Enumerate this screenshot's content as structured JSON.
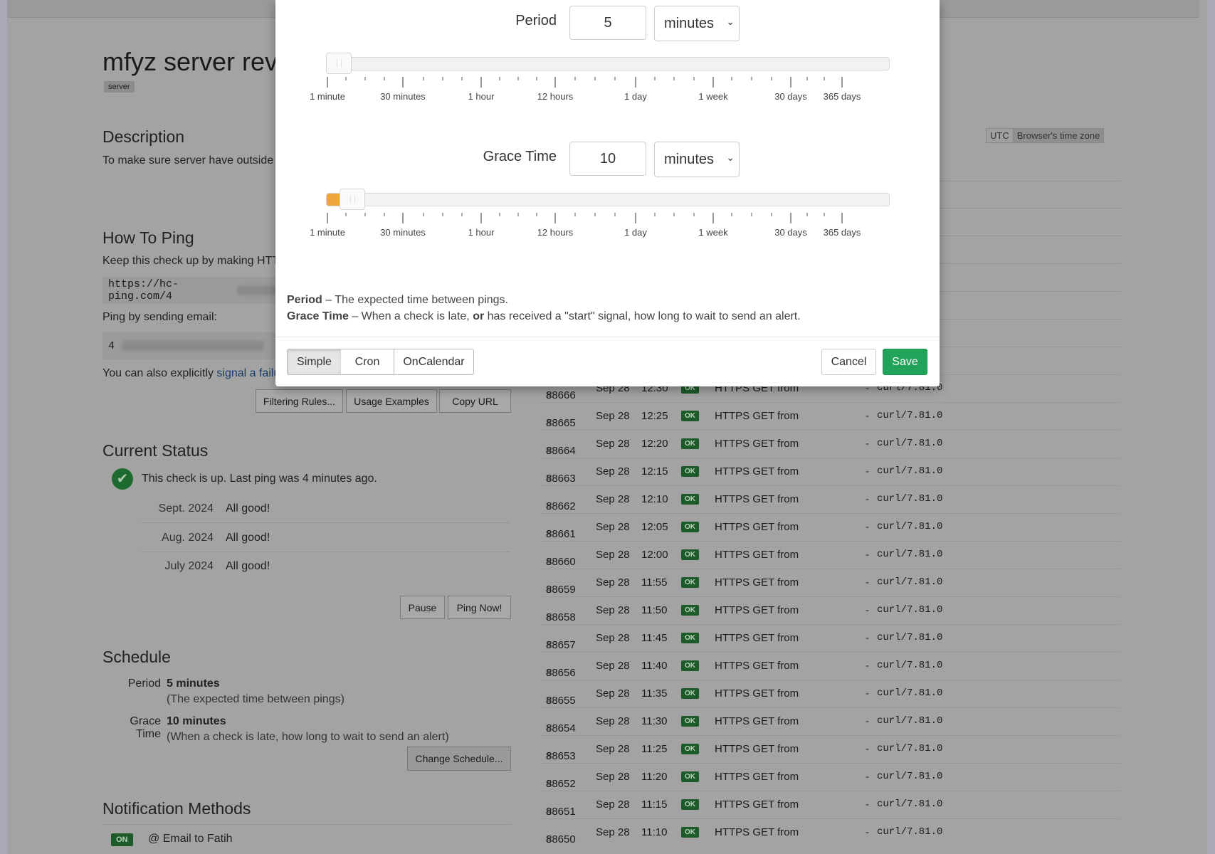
{
  "check": {
    "title": "mfyz server rever",
    "tag": "server",
    "description_heading": "Description",
    "description_text": "To make sure server have outside",
    "how_to_ping_heading": "How To Ping",
    "how_to_ping_text": "Keep this check up by making HTT",
    "ping_url": "https://hc-ping.com/4",
    "ping_email_label": "Ping by sending email:",
    "ping_email": "4",
    "signal_text": "You can also explicitly ",
    "signal_link": "signal a failu",
    "buttons": {
      "filtering": "Filtering Rules...",
      "usage": "Usage Examples",
      "copy": "Copy URL"
    }
  },
  "timezone": {
    "utc": "UTC",
    "browser": "Browser's time zone"
  },
  "status": {
    "heading": "Current Status",
    "text": "This check is up. Last ping was 4 minutes ago.",
    "months": [
      {
        "month": "Sept. 2024",
        "state": "All good!"
      },
      {
        "month": "Aug. 2024",
        "state": "All good!"
      },
      {
        "month": "July 2024",
        "state": "All good!"
      }
    ],
    "pause": "Pause",
    "ping_now": "Ping Now!"
  },
  "schedule": {
    "heading": "Schedule",
    "period_label": "Period",
    "period_value": "5 minutes",
    "period_hint": "(The expected time between pings)",
    "grace_label": "Grace Time",
    "grace_value": "10 minutes",
    "grace_hint": "(When a check is late, how long to wait to send an alert)",
    "change_button": "Change Schedule..."
  },
  "notifications": {
    "heading": "Notification Methods",
    "badge": "ON",
    "method": "Email to Fatih"
  },
  "pings": [
    {
      "id": "88666",
      "date": "Sep 28",
      "time": "12:30",
      "status": "OK",
      "event": "HTTPS GET from",
      "agent": "curl/7.81.0"
    },
    {
      "id": "88665",
      "date": "Sep 28",
      "time": "12:25",
      "status": "OK",
      "event": "HTTPS GET from",
      "agent": "curl/7.81.0"
    },
    {
      "id": "88664",
      "date": "Sep 28",
      "time": "12:20",
      "status": "OK",
      "event": "HTTPS GET from",
      "agent": "curl/7.81.0"
    },
    {
      "id": "88663",
      "date": "Sep 28",
      "time": "12:15",
      "status": "OK",
      "event": "HTTPS GET from",
      "agent": "curl/7.81.0"
    },
    {
      "id": "88662",
      "date": "Sep 28",
      "time": "12:10",
      "status": "OK",
      "event": "HTTPS GET from",
      "agent": "curl/7.81.0"
    },
    {
      "id": "88661",
      "date": "Sep 28",
      "time": "12:05",
      "status": "OK",
      "event": "HTTPS GET from",
      "agent": "curl/7.81.0"
    },
    {
      "id": "88660",
      "date": "Sep 28",
      "time": "12:00",
      "status": "OK",
      "event": "HTTPS GET from",
      "agent": "curl/7.81.0"
    },
    {
      "id": "88659",
      "date": "Sep 28",
      "time": "11:55",
      "status": "OK",
      "event": "HTTPS GET from",
      "agent": "curl/7.81.0"
    },
    {
      "id": "88658",
      "date": "Sep 28",
      "time": "11:50",
      "status": "OK",
      "event": "HTTPS GET from",
      "agent": "curl/7.81.0"
    },
    {
      "id": "88657",
      "date": "Sep 28",
      "time": "11:45",
      "status": "OK",
      "event": "HTTPS GET from",
      "agent": "curl/7.81.0"
    },
    {
      "id": "88656",
      "date": "Sep 28",
      "time": "11:40",
      "status": "OK",
      "event": "HTTPS GET from",
      "agent": "curl/7.81.0"
    },
    {
      "id": "88655",
      "date": "Sep 28",
      "time": "11:35",
      "status": "OK",
      "event": "HTTPS GET from",
      "agent": "curl/7.81.0"
    },
    {
      "id": "88654",
      "date": "Sep 28",
      "time": "11:30",
      "status": "OK",
      "event": "HTTPS GET from",
      "agent": "curl/7.81.0"
    },
    {
      "id": "88653",
      "date": "Sep 28",
      "time": "11:25",
      "status": "OK",
      "event": "HTTPS GET from",
      "agent": "curl/7.81.0"
    },
    {
      "id": "88652",
      "date": "Sep 28",
      "time": "11:20",
      "status": "OK",
      "event": "HTTPS GET from",
      "agent": "curl/7.81.0"
    },
    {
      "id": "88651",
      "date": "Sep 28",
      "time": "11:15",
      "status": "OK",
      "event": "HTTPS GET from",
      "agent": "curl/7.81.0"
    },
    {
      "id": "88650",
      "date": "Sep 28",
      "time": "11:10",
      "status": "OK",
      "event": "HTTPS GET from",
      "agent": "curl/7.81.0"
    }
  ],
  "modal": {
    "period_label": "Period",
    "period_value": "5",
    "period_unit": "minutes",
    "grace_label": "Grace Time",
    "grace_value": "10",
    "grace_unit": "minutes",
    "ticks": [
      "1 minute",
      "30 minutes",
      "1 hour",
      "12 hours",
      "1 day",
      "1 week",
      "30 days",
      "365 days"
    ],
    "help_period_term": "Period",
    "help_period_text": " – The expected time between pings.",
    "help_grace_term": "Grace Time",
    "help_grace_text_a": " – When a check is late, ",
    "help_grace_or": "or",
    "help_grace_text_b": " has received a \"start\" signal, how long to wait to send an alert.",
    "modes": [
      "Simple",
      "Cron",
      "OnCalendar"
    ],
    "active_mode": "Simple",
    "cancel": "Cancel",
    "save": "Save"
  },
  "colors": {
    "save": "#22a35a",
    "grace_fill": "#f0a43c",
    "ok_badge": "#1d5a2a",
    "link": "#0b64c0"
  }
}
